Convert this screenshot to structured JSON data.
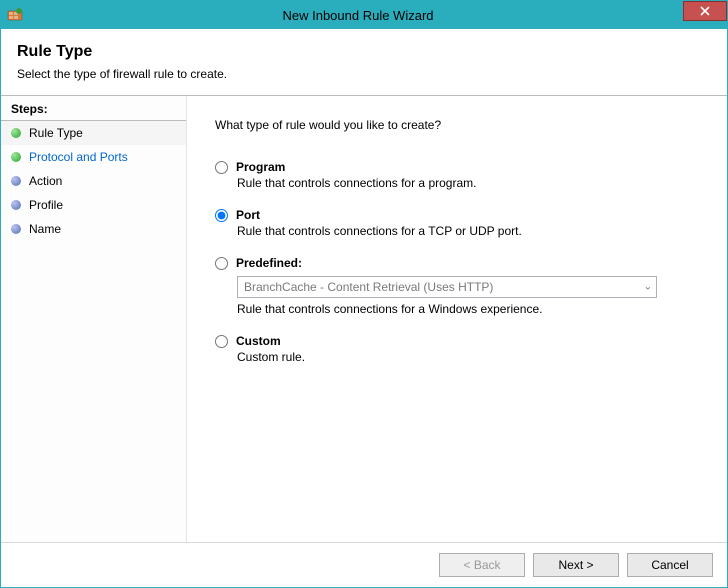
{
  "window": {
    "title": "New Inbound Rule Wizard"
  },
  "header": {
    "title": "Rule Type",
    "subtitle": "Select the type of firewall rule to create."
  },
  "sidebar": {
    "stepsLabel": "Steps:",
    "items": [
      {
        "label": "Rule Type"
      },
      {
        "label": "Protocol and Ports"
      },
      {
        "label": "Action"
      },
      {
        "label": "Profile"
      },
      {
        "label": "Name"
      }
    ]
  },
  "content": {
    "question": "What type of rule would you like to create?",
    "options": {
      "program": {
        "label": "Program",
        "desc": "Rule that controls connections for a program."
      },
      "port": {
        "label": "Port",
        "desc": "Rule that controls connections for a TCP or UDP port."
      },
      "predefined": {
        "label": "Predefined:",
        "dropdown": "BranchCache - Content Retrieval (Uses HTTP)",
        "desc": "Rule that controls connections for a Windows experience."
      },
      "custom": {
        "label": "Custom",
        "desc": "Custom rule."
      }
    },
    "selected": "port"
  },
  "footer": {
    "back": "< Back",
    "next": "Next >",
    "cancel": "Cancel"
  }
}
